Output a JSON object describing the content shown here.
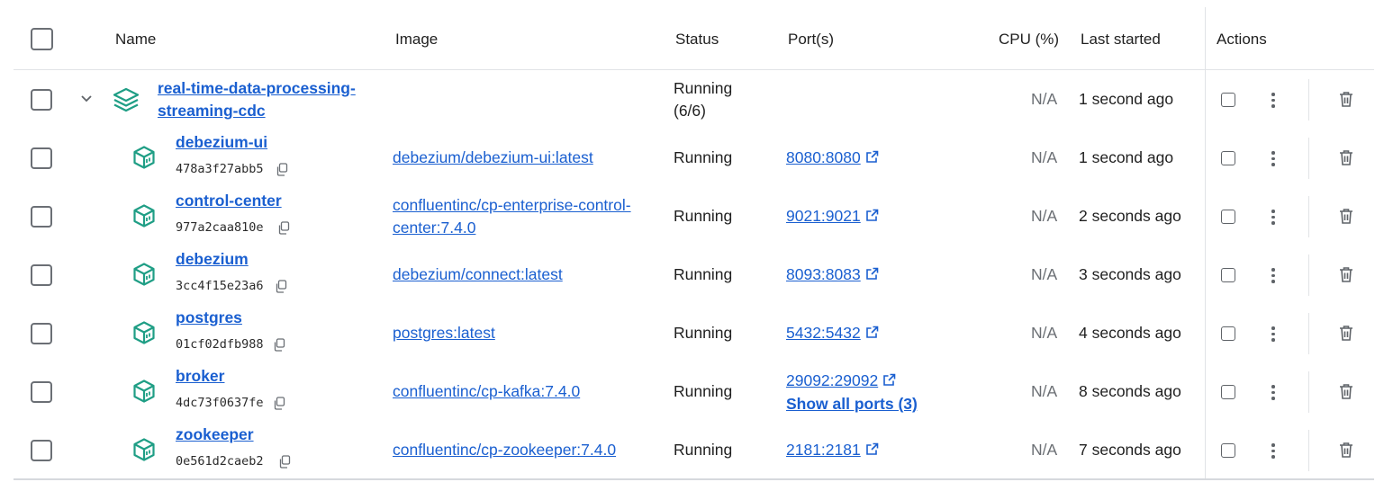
{
  "header": {
    "name": "Name",
    "image": "Image",
    "status": "Status",
    "ports": "Port(s)",
    "cpu": "CPU (%)",
    "last_started": "Last started",
    "actions": "Actions"
  },
  "group": {
    "name_line1": "real-time-data-processing-",
    "name_line2": "streaming-cdc",
    "status_line1": "Running",
    "status_line2": "(6/6)",
    "cpu": "N/A",
    "last_started": "1 second ago"
  },
  "containers": [
    {
      "name": "debezium-ui",
      "id": "478a3f27abb5",
      "image_line1": "debezium/debezium-ui:latest",
      "image_line2": "",
      "status": "Running",
      "port": "8080:8080",
      "port_extra": "",
      "cpu": "N/A",
      "last_started": "1 second ago"
    },
    {
      "name": "control-center",
      "id": "977a2caa810e",
      "image_line1": "confluentinc/cp-enterprise-control-",
      "image_line2": "center:7.4.0",
      "status": "Running",
      "port": "9021:9021",
      "port_extra": "",
      "cpu": "N/A",
      "last_started": "2 seconds ago"
    },
    {
      "name": "debezium",
      "id": "3cc4f15e23a6",
      "image_line1": "debezium/connect:latest",
      "image_line2": "",
      "status": "Running",
      "port": "8093:8083",
      "port_extra": "",
      "cpu": "N/A",
      "last_started": "3 seconds ago"
    },
    {
      "name": "postgres",
      "id": "01cf02dfb988",
      "image_line1": "postgres:latest",
      "image_line2": "",
      "status": "Running",
      "port": "5432:5432",
      "port_extra": "",
      "cpu": "N/A",
      "last_started": "4 seconds ago"
    },
    {
      "name": "broker",
      "id": "4dc73f0637fe",
      "image_line1": "confluentinc/cp-kafka:7.4.0",
      "image_line2": "",
      "status": "Running",
      "port": "29092:29092",
      "port_extra": "Show all ports (3)",
      "cpu": "N/A",
      "last_started": "8 seconds ago"
    },
    {
      "name": "zookeeper",
      "id": "0e561d2caeb2",
      "image_line1": "confluentinc/cp-zookeeper:7.4.0",
      "image_line2": "",
      "status": "Running",
      "port": "2181:2181",
      "port_extra": "",
      "cpu": "N/A",
      "last_started": "7 seconds ago"
    }
  ],
  "icons": {
    "group": "stack-layers-icon",
    "container": "container-cube-icon",
    "copy": "copy-icon",
    "external": "external-link-icon",
    "more": "more-vertical-icon",
    "delete": "trash-icon",
    "expand": "chevron-down-icon"
  },
  "colors": {
    "link": "#1a5fd0",
    "icon_teal": "#1f9e85",
    "muted": "#6a6e73"
  }
}
